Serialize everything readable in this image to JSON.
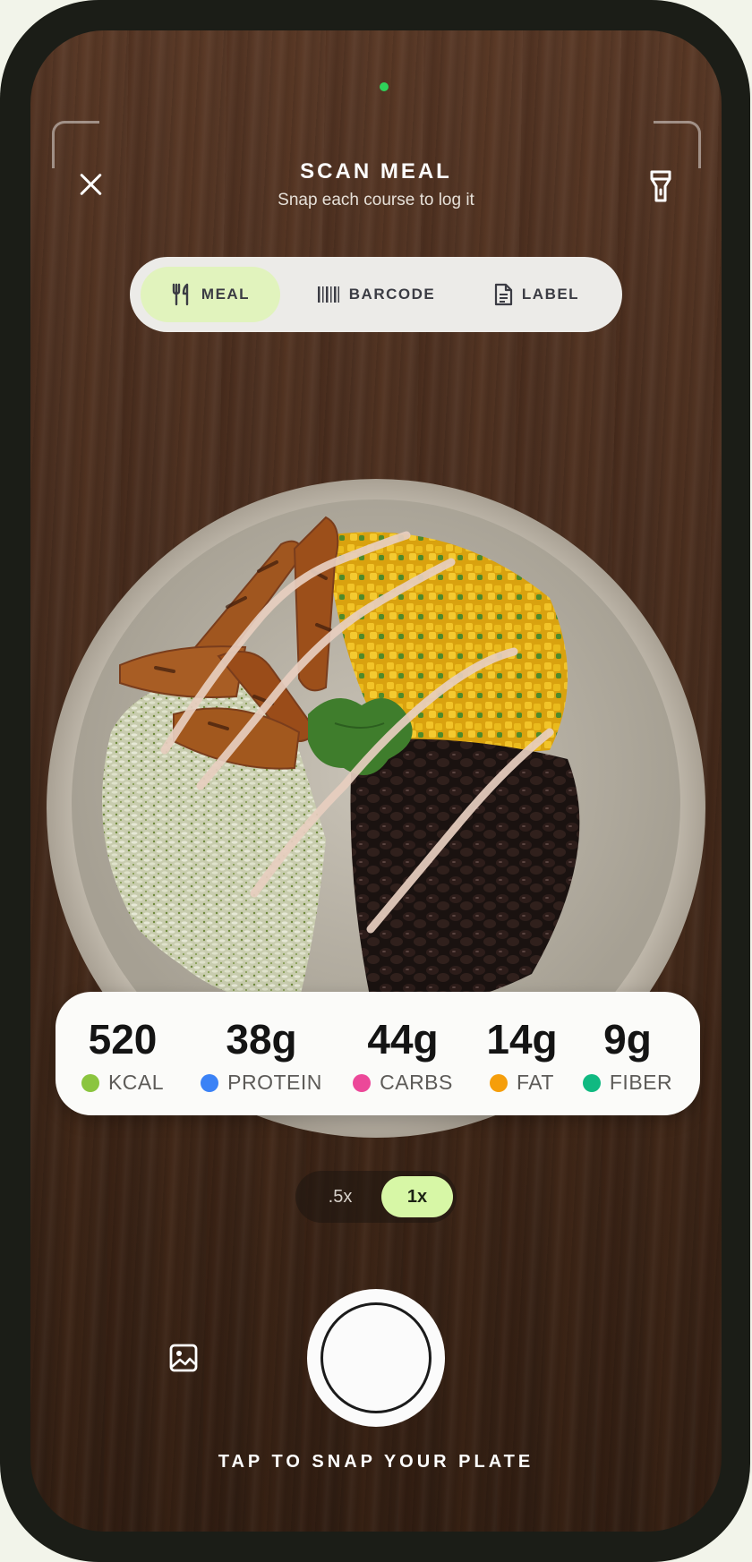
{
  "header": {
    "title": "SCAN MEAL",
    "subtitle": "Snap each course to log it"
  },
  "modes": [
    {
      "label": "MEAL",
      "icon": "fork-knife-icon",
      "active": true
    },
    {
      "label": "BARCODE",
      "icon": "barcode-icon",
      "active": false
    },
    {
      "label": "LABEL",
      "icon": "document-icon",
      "active": false
    }
  ],
  "macros": [
    {
      "value": "520",
      "label": "KCAL",
      "color": "#8bc53f"
    },
    {
      "value": "38g",
      "label": "PROTEIN",
      "color": "#3b82f6"
    },
    {
      "value": "44g",
      "label": "CARBS",
      "color": "#ec4899"
    },
    {
      "value": "14g",
      "label": "FAT",
      "color": "#f59e0b"
    },
    {
      "value": "9g",
      "label": "FIBER",
      "color": "#10b981"
    }
  ],
  "zoom": {
    "options": [
      ".5x",
      "1x"
    ],
    "selected": "1x"
  },
  "capture": {
    "hint": "TAP TO SNAP YOUR PLATE"
  },
  "icons": {
    "close": "close-icon",
    "flash": "flashlight-icon",
    "gallery": "gallery-icon"
  },
  "colors": {
    "active_mode": "#e1f3bd",
    "active_zoom": "#d7f7a6",
    "indicator": "#2fd35a"
  }
}
